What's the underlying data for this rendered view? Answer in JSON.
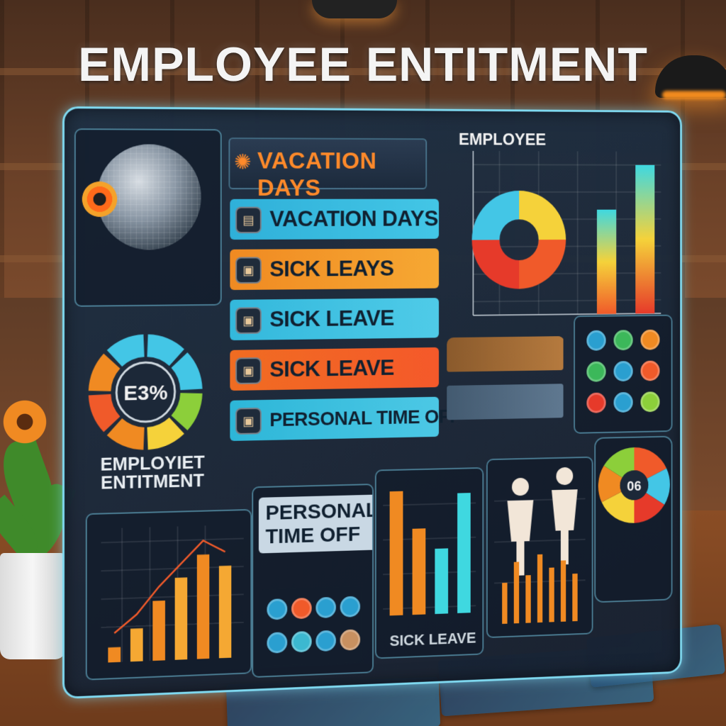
{
  "main_title": "EMPLOYEE ENTITMENT",
  "panel": {
    "vacation_header": "VACATION DAYS",
    "list_items": [
      {
        "label": "VACATION DAYS",
        "icon": "folder-icon"
      },
      {
        "label": "SICK LEAYS",
        "icon": "document-icon"
      },
      {
        "label": "SICK LEAVE",
        "icon": "document-icon"
      },
      {
        "label": "SICK LEAVE",
        "icon": "document-icon"
      },
      {
        "label": "PERSONAL TIME OFF",
        "icon": "document-icon"
      }
    ],
    "employee_chart_title": "EMPLOYEE",
    "gauge_value": "E3%",
    "gauge_label": "EMPLOYIET ENTITMENT",
    "personal_time_off_title": "PERSONAL TIME OFF",
    "sick_leave_label": "SICK LEAVE",
    "pie_center_label": "06"
  },
  "colors": {
    "accent_cyan": "#43c6e6",
    "accent_orange": "#f08a22",
    "accent_red": "#f05a2a",
    "accent_yellow": "#f5d23a",
    "panel_border": "#7fd9f0"
  },
  "chart_data": [
    {
      "type": "bar",
      "title": "EMPLOYEE",
      "categories": [
        "",
        "",
        "",
        "",
        ""
      ],
      "values": [
        0,
        0,
        0,
        70,
        100
      ],
      "note": "donut combined with bars in top-right panel"
    },
    {
      "type": "pie",
      "values": [
        25,
        25,
        25,
        25
      ]
    },
    {
      "type": "bar",
      "values": [
        10,
        22,
        40,
        55,
        70,
        62
      ]
    },
    {
      "type": "bar",
      "values": [
        72,
        50,
        38,
        70
      ]
    }
  ]
}
